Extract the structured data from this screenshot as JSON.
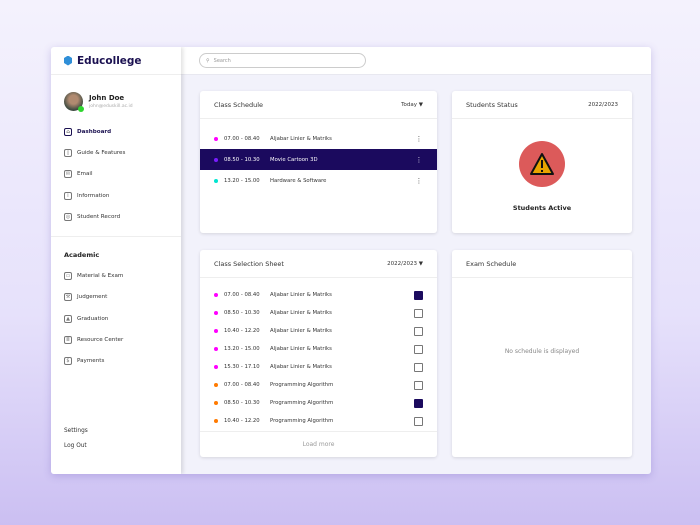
{
  "app": {
    "name": "Educollege"
  },
  "user": {
    "name": "John Doe",
    "email": "john@eduskill.ac.id"
  },
  "nav": [
    {
      "label": "Dashboard",
      "icon": "home-icon"
    },
    {
      "label": "Guide & Features",
      "icon": "book-icon"
    },
    {
      "label": "Email",
      "icon": "mail-icon"
    },
    {
      "label": "Information",
      "icon": "info-icon"
    },
    {
      "label": "Student Record",
      "icon": "award-icon"
    }
  ],
  "academic": {
    "title": "Academic",
    "items": [
      {
        "label": "Material & Exam",
        "icon": "monitor-icon"
      },
      {
        "label": "Judgement",
        "icon": "gavel-icon"
      },
      {
        "label": "Graduation",
        "icon": "graduation-cap-icon"
      },
      {
        "label": "Resource Center",
        "icon": "bank-icon"
      },
      {
        "label": "Payments",
        "icon": "payment-icon"
      }
    ]
  },
  "footer": {
    "settings": "Settings",
    "logout": "Log Out"
  },
  "search": {
    "placeholder": "Search"
  },
  "schedule": {
    "title": "Class Schedule",
    "filter": "Today",
    "rows": [
      {
        "time": "07.00 - 08.40",
        "subject": "Aljabar Linier & Matriks",
        "color": "#ff00ff"
      },
      {
        "time": "08.50 - 10.30",
        "subject": "Movie Cartoon 3D",
        "color": "#7a1cff"
      },
      {
        "time": "13.20 - 15.00",
        "subject": "Hardware & Software",
        "color": "#00e5d0"
      }
    ]
  },
  "status": {
    "title": "Students Status",
    "year": "2022/2023",
    "label": "Students Active"
  },
  "selection": {
    "title": "Class Selection Sheet",
    "year": "2022/2023",
    "load_more": "Load more",
    "rows": [
      {
        "time": "07.00 - 08.40",
        "subject": "Aljabar Linier & Matriks",
        "color": "#ff00ff",
        "checked": true
      },
      {
        "time": "08.50 - 10.30",
        "subject": "Aljabar Linier & Matriks",
        "color": "#ff00ff",
        "checked": false
      },
      {
        "time": "10.40 - 12.20",
        "subject": "Aljabar Linier & Matriks",
        "color": "#ff00ff",
        "checked": false
      },
      {
        "time": "13.20 - 15.00",
        "subject": "Aljabar Linier & Matriks",
        "color": "#ff00ff",
        "checked": false
      },
      {
        "time": "15.30 - 17.10",
        "subject": "Aljabar Linier & Matriks",
        "color": "#ff00ff",
        "checked": false
      },
      {
        "time": "07.00 - 08.40",
        "subject": "Programming Algorithm",
        "color": "#ff7a00",
        "checked": false
      },
      {
        "time": "08.50 - 10.30",
        "subject": "Programming Algorithm",
        "color": "#ff7a00",
        "checked": true
      },
      {
        "time": "10.40 - 12.20",
        "subject": "Programming Algorithm",
        "color": "#ff7a00",
        "checked": false
      }
    ]
  },
  "exam": {
    "title": "Exam Schedule",
    "empty": "No schedule is displayed"
  }
}
